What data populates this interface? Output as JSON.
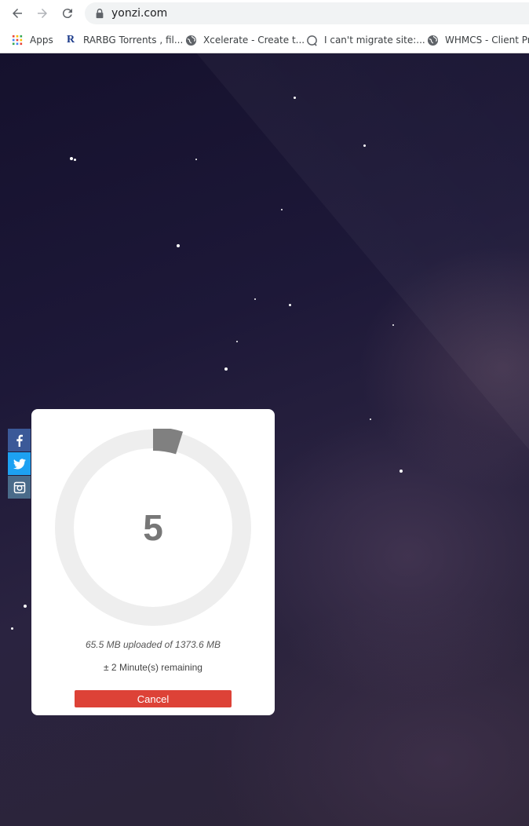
{
  "browser": {
    "url": "yonzi.com",
    "bookmarks": [
      {
        "label": "Apps",
        "icon": "apps-grid-icon"
      },
      {
        "label": "RARBG Torrents , fil...",
        "icon": "rarbg-r-icon"
      },
      {
        "label": "Xcelerate - Create t...",
        "icon": "globe-icon"
      },
      {
        "label": "I can't migrate site:...",
        "icon": "question-icon"
      },
      {
        "label": "WHMCS - Client Pr...",
        "icon": "globe-icon"
      }
    ]
  },
  "social": [
    {
      "name": "facebook",
      "icon": "facebook-icon",
      "color": "#3b5998"
    },
    {
      "name": "twitter",
      "icon": "twitter-icon",
      "color": "#1da1f2"
    },
    {
      "name": "instagram",
      "icon": "instagram-icon",
      "color": "#4a6b8a"
    }
  ],
  "upload": {
    "count": "5",
    "progress_fraction": 0.048,
    "uploaded_text": "65.5 MB uploaded of 1373.6 MB",
    "remaining_text": "± 2 Minute(s) remaining",
    "cancel_label": "Cancel",
    "ring_track_color": "#eeeeee",
    "ring_fill_color": "#808080",
    "cancel_color": "#dd4237"
  }
}
